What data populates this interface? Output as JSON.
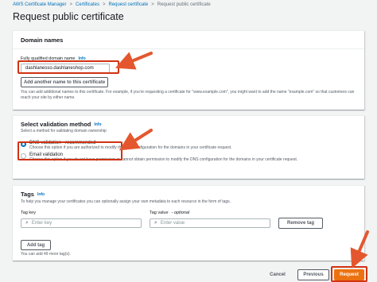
{
  "breadcrumb": {
    "items": [
      "AWS Certificate Manager",
      "Certificates",
      "Request certificate"
    ],
    "current": "Request public certificate",
    "sep": ">"
  },
  "page_title": "Request public certificate",
  "domain_names": {
    "header": "Domain names",
    "field_label": "Fully qualified domain name",
    "info": "Info",
    "value": "dashlanesso.dashlaneshop.com",
    "add_button": "Add another name to this certificate",
    "helper": "You can add additional names to this certificate. For example, if you're requesting a certificate for \"www.example.com\", you might want to add the name \"example.com\" so that customers can reach your site by either name."
  },
  "validation": {
    "header": "Select validation method",
    "info": "Info",
    "subtitle": "Select a method for validating domain ownership",
    "options": [
      {
        "label": "DNS validation - recommended",
        "desc": "Choose this option if you are authorized to modify the DNS configuration for the domains in your certificate request.",
        "checked": true
      },
      {
        "label": "Email validation",
        "desc": "Choose this option if you do not have permission or cannot obtain permission to modify the DNS configuration for the domains in your certificate request.",
        "checked": false
      }
    ]
  },
  "tags": {
    "header": "Tags",
    "info": "Info",
    "subtitle": "To help you manage your certificates you can optionally assign your own metadata to each resource in the form of tags.",
    "key_label": "Tag key",
    "value_label": "Tag value",
    "value_optional": "- optional",
    "key_placeholder": "Enter key",
    "value_placeholder": "Enter value",
    "remove_button": "Remove tag",
    "add_button": "Add tag",
    "remaining": "You can add 49 more tag(s)."
  },
  "footer": {
    "cancel": "Cancel",
    "previous": "Previous",
    "request": "Request"
  },
  "colors": {
    "accent": "#ec7211",
    "link": "#0073bb",
    "annotation": "#d13212"
  }
}
